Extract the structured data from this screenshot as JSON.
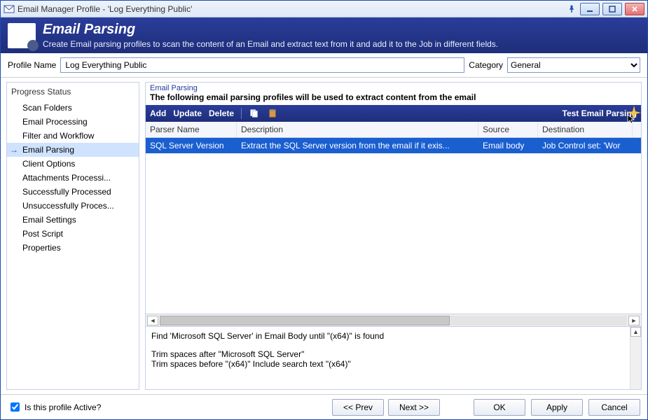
{
  "window": {
    "title": "Email Manager Profile - 'Log Everything Public'"
  },
  "banner": {
    "heading": "Email Parsing",
    "description": "Create Email parsing profiles to scan the content of an Email and extract text from it and add it to the Job in different fields."
  },
  "profile": {
    "name_label": "Profile Name",
    "name_value": "Log Everything Public",
    "category_label": "Category",
    "category_value": "General"
  },
  "sidebar": {
    "heading": "Progress Status",
    "items": [
      "Scan Folders",
      "Email Processing",
      "Filter and Workflow",
      "Email Parsing",
      "Client Options",
      "Attachments Processi...",
      "Successfully Processed",
      "Unsuccessfully Proces...",
      "Email Settings",
      "Post Script",
      "Properties"
    ],
    "selected_index": 3
  },
  "section": {
    "legend": "Email Parsing",
    "subdesc": "The following email parsing profiles will be used to extract content from the email"
  },
  "toolbar": {
    "add": "Add",
    "update": "Update",
    "delete": "Delete",
    "test": "Test Email Parsing"
  },
  "grid": {
    "columns": {
      "name": "Parser Name",
      "desc": "Description",
      "src": "Source",
      "dest": "Destination"
    },
    "rows": [
      {
        "name": "SQL Server Version",
        "desc": "Extract the SQL Server version from the email if it exis...",
        "src": "Email body",
        "dest": "Job Control set: 'Wor"
      }
    ]
  },
  "detail": {
    "line1": "Find 'Microsoft SQL Server' in Email Body until \"(x64)\" is found",
    "line2": "Trim spaces after \"Microsoft SQL Server\"",
    "line3": "Trim spaces before \"(x64)\" Include search text \"(x64)\""
  },
  "footer": {
    "active_label": "Is this profile Active?",
    "active_checked": true,
    "prev": "<< Prev",
    "next": "Next >>",
    "ok": "OK",
    "apply": "Apply",
    "cancel": "Cancel"
  }
}
